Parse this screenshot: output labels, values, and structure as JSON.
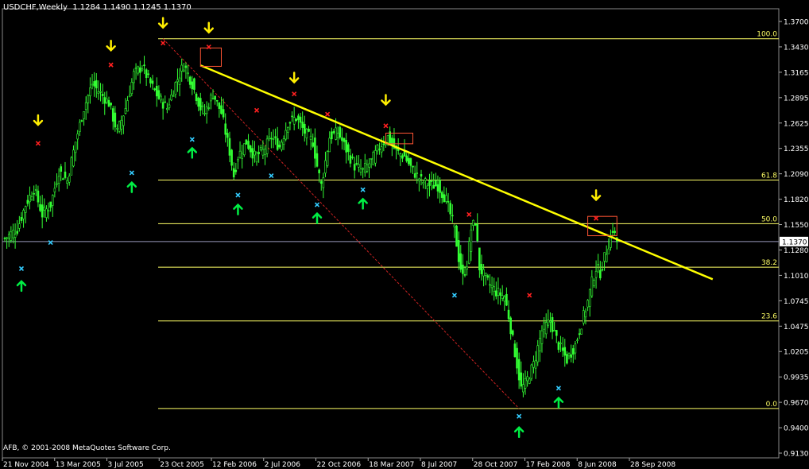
{
  "header": {
    "symbol": "USDCHF,Weekly",
    "ohlc": "1.1284 1.1490 1.1245 1.1370"
  },
  "copyright": "AFB, © 2001-2008 MetaQuotes Software Corp.",
  "colors": {
    "background": "#000000",
    "candles": "#33ff33",
    "fib_line": "#ffff66",
    "trendline": "#ffff00",
    "dashed_line": "#cc2222",
    "red_mark": "#ff2020",
    "cyan_mark": "#33ccff",
    "up_arrow": "#00ee44",
    "down_arrow": "#ffee00",
    "box": "#ff5533",
    "price_line": "#9999bb"
  },
  "chart_data": {
    "type": "candlestick",
    "title": "USDCHF,Weekly",
    "ylim": [
      0.9135,
      1.3775
    ],
    "y_ticks": [
      "1.3700",
      "1.3430",
      "1.3165",
      "1.2895",
      "1.2625",
      "1.2355",
      "1.2090",
      "1.1820",
      "1.1550",
      "1.1280",
      "1.1010",
      "1.0745",
      "1.0475",
      "1.0205",
      "0.9935",
      "0.9670",
      "0.9400",
      "0.9130"
    ],
    "x_ticks": [
      "21 Nov 2004",
      "13 Mar 2005",
      "3 Jul 2005",
      "23 Oct 2005",
      "12 Feb 2006",
      "2 Jul 2006",
      "22 Oct 2006",
      "18 Mar 2007",
      "8 Jul 2007",
      "28 Oct 2007",
      "17 Feb 2008",
      "8 Jun 2008",
      "28 Sep 2008"
    ],
    "current_price": "1.1370",
    "grid": false,
    "close_path": [
      [
        0,
        1.14
      ],
      [
        6,
        1.15
      ],
      [
        10,
        1.175
      ],
      [
        14,
        1.192
      ],
      [
        18,
        1.165
      ],
      [
        22,
        1.175
      ],
      [
        26,
        1.21
      ],
      [
        30,
        1.2
      ],
      [
        34,
        1.24
      ],
      [
        38,
        1.275
      ],
      [
        42,
        1.3
      ],
      [
        46,
        1.29
      ],
      [
        50,
        1.28
      ],
      [
        54,
        1.25
      ],
      [
        58,
        1.275
      ],
      [
        62,
        1.31
      ],
      [
        66,
        1.318
      ],
      [
        70,
        1.3
      ],
      [
        74,
        1.285
      ],
      [
        78,
        1.275
      ],
      [
        82,
        1.3
      ],
      [
        86,
        1.32
      ],
      [
        90,
        1.3
      ],
      [
        94,
        1.275
      ],
      [
        96,
        1.27
      ],
      [
        100,
        1.29
      ],
      [
        104,
        1.27
      ],
      [
        108,
        1.23
      ],
      [
        110,
        1.205
      ],
      [
        112,
        1.225
      ],
      [
        116,
        1.24
      ],
      [
        120,
        1.225
      ],
      [
        124,
        1.23
      ],
      [
        128,
        1.245
      ],
      [
        132,
        1.235
      ],
      [
        136,
        1.26
      ],
      [
        140,
        1.265
      ],
      [
        144,
        1.25
      ],
      [
        148,
        1.24
      ],
      [
        150,
        1.215
      ],
      [
        152,
        1.195
      ],
      [
        154,
        1.22
      ],
      [
        156,
        1.245
      ],
      [
        160,
        1.25
      ],
      [
        164,
        1.232
      ],
      [
        168,
        1.215
      ],
      [
        172,
        1.21
      ],
      [
        176,
        1.22
      ],
      [
        180,
        1.235
      ],
      [
        184,
        1.245
      ],
      [
        188,
        1.23
      ],
      [
        192,
        1.225
      ],
      [
        196,
        1.21
      ],
      [
        200,
        1.2
      ],
      [
        204,
        1.195
      ],
      [
        208,
        1.195
      ],
      [
        212,
        1.18
      ],
      [
        214,
        1.165
      ],
      [
        216,
        1.15
      ],
      [
        218,
        1.12
      ],
      [
        220,
        1.1
      ],
      [
        222,
        1.115
      ],
      [
        224,
        1.15
      ],
      [
        226,
        1.158
      ],
      [
        228,
        1.11
      ],
      [
        232,
        1.095
      ],
      [
        236,
        1.085
      ],
      [
        240,
        1.08
      ],
      [
        242,
        1.06
      ],
      [
        244,
        1.035
      ],
      [
        246,
        1.01
      ],
      [
        248,
        0.985
      ],
      [
        250,
        0.99
      ],
      [
        254,
        1.01
      ],
      [
        258,
        1.045
      ],
      [
        262,
        1.055
      ],
      [
        266,
        1.03
      ],
      [
        270,
        1.015
      ],
      [
        274,
        1.03
      ],
      [
        278,
        1.06
      ],
      [
        280,
        1.075
      ],
      [
        282,
        1.095
      ],
      [
        284,
        1.11
      ],
      [
        286,
        1.105
      ],
      [
        288,
        1.12
      ],
      [
        290,
        1.135
      ],
      [
        292,
        1.15
      ],
      [
        294,
        1.137
      ]
    ],
    "fibonacci": [
      {
        "level": "100.0",
        "price": 1.3465
      },
      {
        "level": "61.8",
        "price": 1.2005
      },
      {
        "level": "50.0",
        "price": 1.1555
      },
      {
        "level": "38.2",
        "price": 1.1105
      },
      {
        "level": "23.6",
        "price": 1.055
      },
      {
        "level": "0.0",
        "price": 0.9645
      }
    ],
    "trendline": {
      "from": [
        94,
        1.319
      ],
      "to": [
        340,
        1.098
      ]
    },
    "dashed_line": {
      "from": [
        76,
        1.3465
      ],
      "to": [
        247,
        0.9645
      ]
    },
    "boxes": [
      {
        "x": [
          94,
          104
        ],
        "y": [
          1.318,
          1.337
        ]
      },
      {
        "x": [
          183,
          196
        ],
        "y": [
          1.238,
          1.249
        ]
      },
      {
        "x": [
          280,
          294
        ],
        "y": [
          1.143,
          1.163
        ]
      }
    ],
    "red_marks": [
      [
        16,
        1.2385
      ],
      [
        51,
        1.3195
      ],
      [
        76,
        1.342
      ],
      [
        98,
        1.338
      ],
      [
        121,
        1.2725
      ],
      [
        139,
        1.2895
      ],
      [
        155,
        1.2685
      ],
      [
        183,
        1.2565
      ],
      [
        223,
        1.165
      ],
      [
        252,
        1.0815
      ],
      [
        284,
        1.161
      ]
    ],
    "cyan_marks": [
      [
        8,
        1.109
      ],
      [
        22,
        1.136
      ],
      [
        61,
        1.208
      ],
      [
        90,
        1.2425
      ],
      [
        112,
        1.185
      ],
      [
        128,
        1.205
      ],
      [
        150,
        1.175
      ],
      [
        172,
        1.1905
      ],
      [
        216,
        1.0815
      ],
      [
        247,
        0.9565
      ],
      [
        266,
        0.9855
      ]
    ],
    "up_arrows": [
      [
        8,
        1.091
      ],
      [
        61,
        1.193
      ],
      [
        90,
        1.2285
      ],
      [
        112,
        1.17
      ],
      [
        150,
        1.161
      ],
      [
        172,
        1.176
      ],
      [
        247,
        0.94
      ],
      [
        266,
        0.9705
      ]
    ],
    "down_arrows": [
      [
        16,
        1.2625
      ],
      [
        51,
        1.3395
      ],
      [
        76,
        1.363
      ],
      [
        98,
        1.358
      ],
      [
        139,
        1.3065
      ],
      [
        183,
        1.2835
      ],
      [
        284,
        1.185
      ]
    ]
  }
}
